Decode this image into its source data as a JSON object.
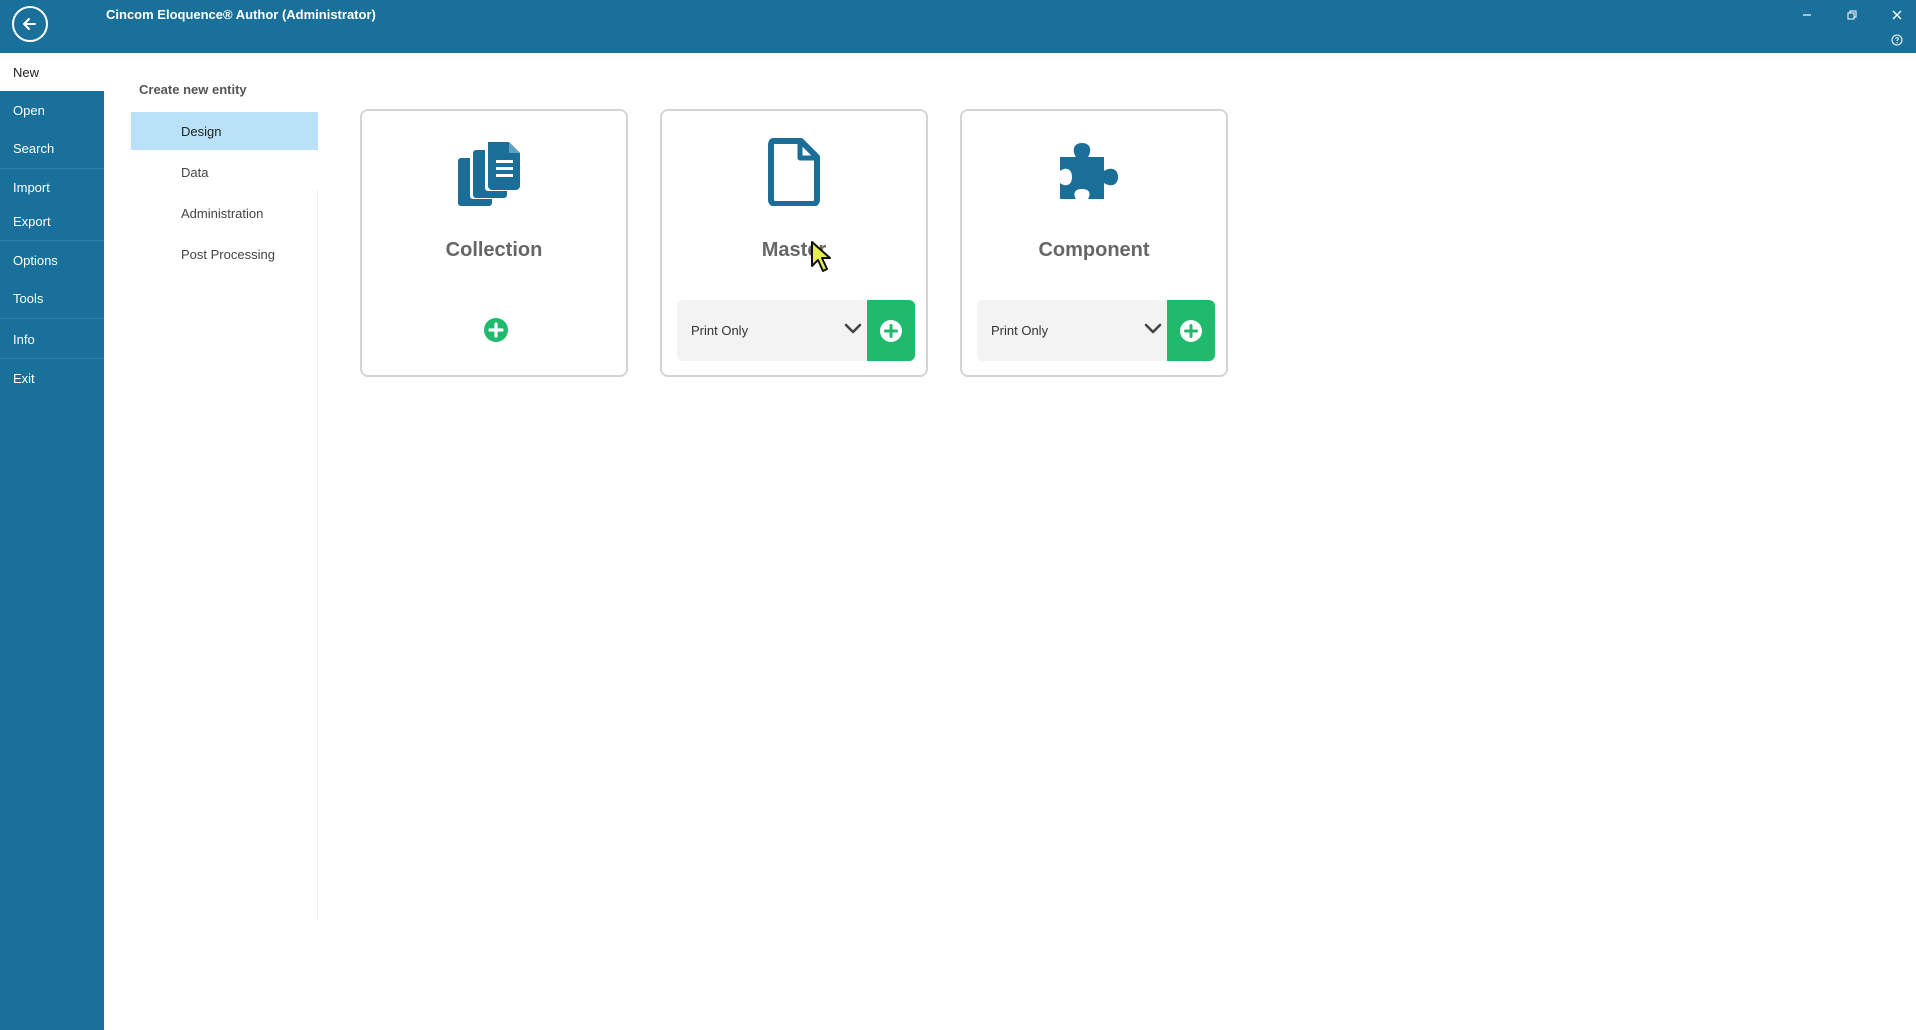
{
  "app": {
    "title": "Cincom Eloquence® Author (Administrator)"
  },
  "window_controls": [
    "minimize-icon",
    "restore-icon",
    "close-icon",
    "help-icon"
  ],
  "nav": {
    "items": [
      {
        "label": "New",
        "active": true
      },
      {
        "label": "Open"
      },
      {
        "label": "Search"
      },
      {
        "label": "Import"
      },
      {
        "label": "Export"
      },
      {
        "label": "Options"
      },
      {
        "label": "Tools"
      },
      {
        "label": "Info"
      },
      {
        "label": "Exit"
      }
    ]
  },
  "categories": {
    "heading": "Create new entity",
    "items": [
      {
        "label": "Design",
        "selected": true
      },
      {
        "label": "Data"
      },
      {
        "label": "Administration"
      },
      {
        "label": "Post Processing"
      }
    ]
  },
  "cards": [
    {
      "title": "Collection",
      "icon": "collection-icon"
    },
    {
      "title": "Master",
      "icon": "document-icon",
      "select_value": "Print Only"
    },
    {
      "title": "Component",
      "icon": "puzzle-icon",
      "select_value": "Print Only"
    }
  ],
  "colors": {
    "header": "#19709a",
    "nav_background": "#19709a",
    "icon_blue": "#1b6e98",
    "selected_category": "#b9e1f7",
    "add_green": "#1fba6b"
  }
}
